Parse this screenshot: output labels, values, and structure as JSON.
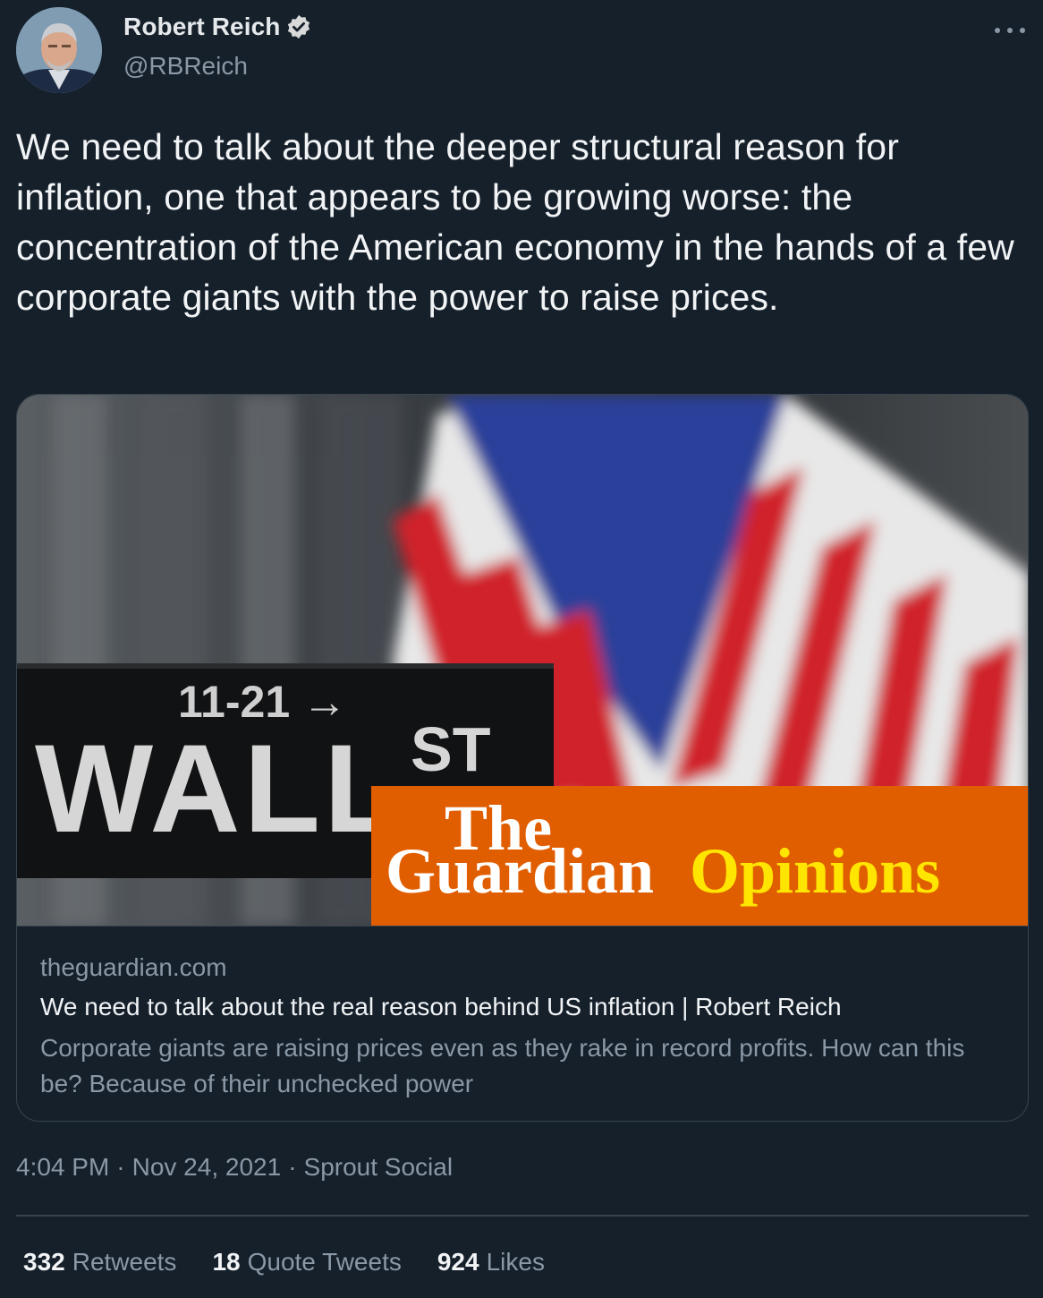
{
  "author": {
    "name": "Robert Reich",
    "handle": "@RBReich",
    "verified": true,
    "avatar_icon": "profile-photo"
  },
  "tweet": {
    "text": "We need to talk about the deeper structural reason for inflation, one that appears to be growing worse: the concentration of the American economy in the hands of a few corporate giants with the power to raise prices.",
    "timestamp_time": "4:04 PM",
    "separator": "·",
    "timestamp_date": "Nov 24, 2021",
    "source": "Sprout Social"
  },
  "card": {
    "domain": "theguardian.com",
    "title": "We need to talk about the real reason behind US inflation | Robert Reich",
    "description": "Corporate giants are raising prices even as they rake in record profits. How can this be? Because of their unchecked power",
    "image": {
      "sign_arrow": "11-21 →",
      "sign_wall": "WALL",
      "sign_st": "ST",
      "brand_the": "The",
      "brand_guardian": "Guardian",
      "brand_opinions": "Opinions",
      "brand_bg_color": "#e05e00",
      "brand_accent_color": "#ffe500"
    }
  },
  "stats": {
    "retweets_count": "332",
    "retweets_label": "Retweets",
    "quotes_count": "18",
    "quotes_label": "Quote Tweets",
    "likes_count": "924",
    "likes_label": "Likes"
  },
  "colors": {
    "background": "#15202b",
    "verified_badge": "#d9d9d9",
    "border": "#38444d"
  }
}
